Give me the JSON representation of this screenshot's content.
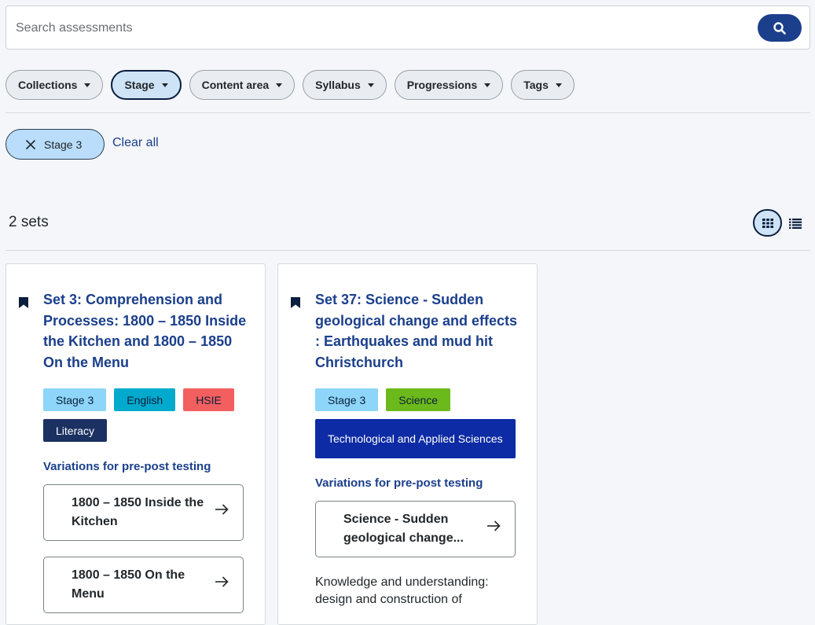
{
  "search": {
    "placeholder": "Search assessments",
    "button_icon": "search-icon"
  },
  "filters": [
    {
      "label": "Collections"
    },
    {
      "label": "Stage"
    },
    {
      "label": "Content area"
    },
    {
      "label": "Syllabus"
    },
    {
      "label": "Progressions"
    },
    {
      "label": "Tags"
    }
  ],
  "active_filters": {
    "chip_label": "Stage 3",
    "clear_label": "Clear all"
  },
  "results": {
    "count_label": "2 sets",
    "view": "grid"
  },
  "cards": [
    {
      "title": "Set 3: Comprehension and Processes: 1800 – 1850 Inside the Kitchen and 1800 – 1850 On the Menu",
      "tags": [
        "Stage 3",
        "English",
        "HSIE",
        "Literacy"
      ],
      "variations_heading": "Variations for pre-post testing",
      "variations": [
        "1800 – 1850 Inside the Kitchen",
        "1800 – 1850 On the Menu"
      ]
    },
    {
      "title": "Set 37: Science - Sudden geological change and effects : Earthquakes and mud hit Christchurch",
      "tags": [
        "Stage 3",
        "Science",
        "Technological and Applied Sciences"
      ],
      "variations_heading": "Variations for pre-post testing",
      "variations": [
        "Science - Sudden geological change..."
      ],
      "description": "Knowledge and understanding: design and construction of"
    }
  ],
  "colors": {
    "primary": "#1b3f8b",
    "stage_tag": "#8dd6f9",
    "english_tag": "#00aacd",
    "hsie_tag": "#f35f5f",
    "literacy_tag": "#1b3161",
    "science_tag": "#6cb91b",
    "tas_tag": "#0d2ba4"
  }
}
